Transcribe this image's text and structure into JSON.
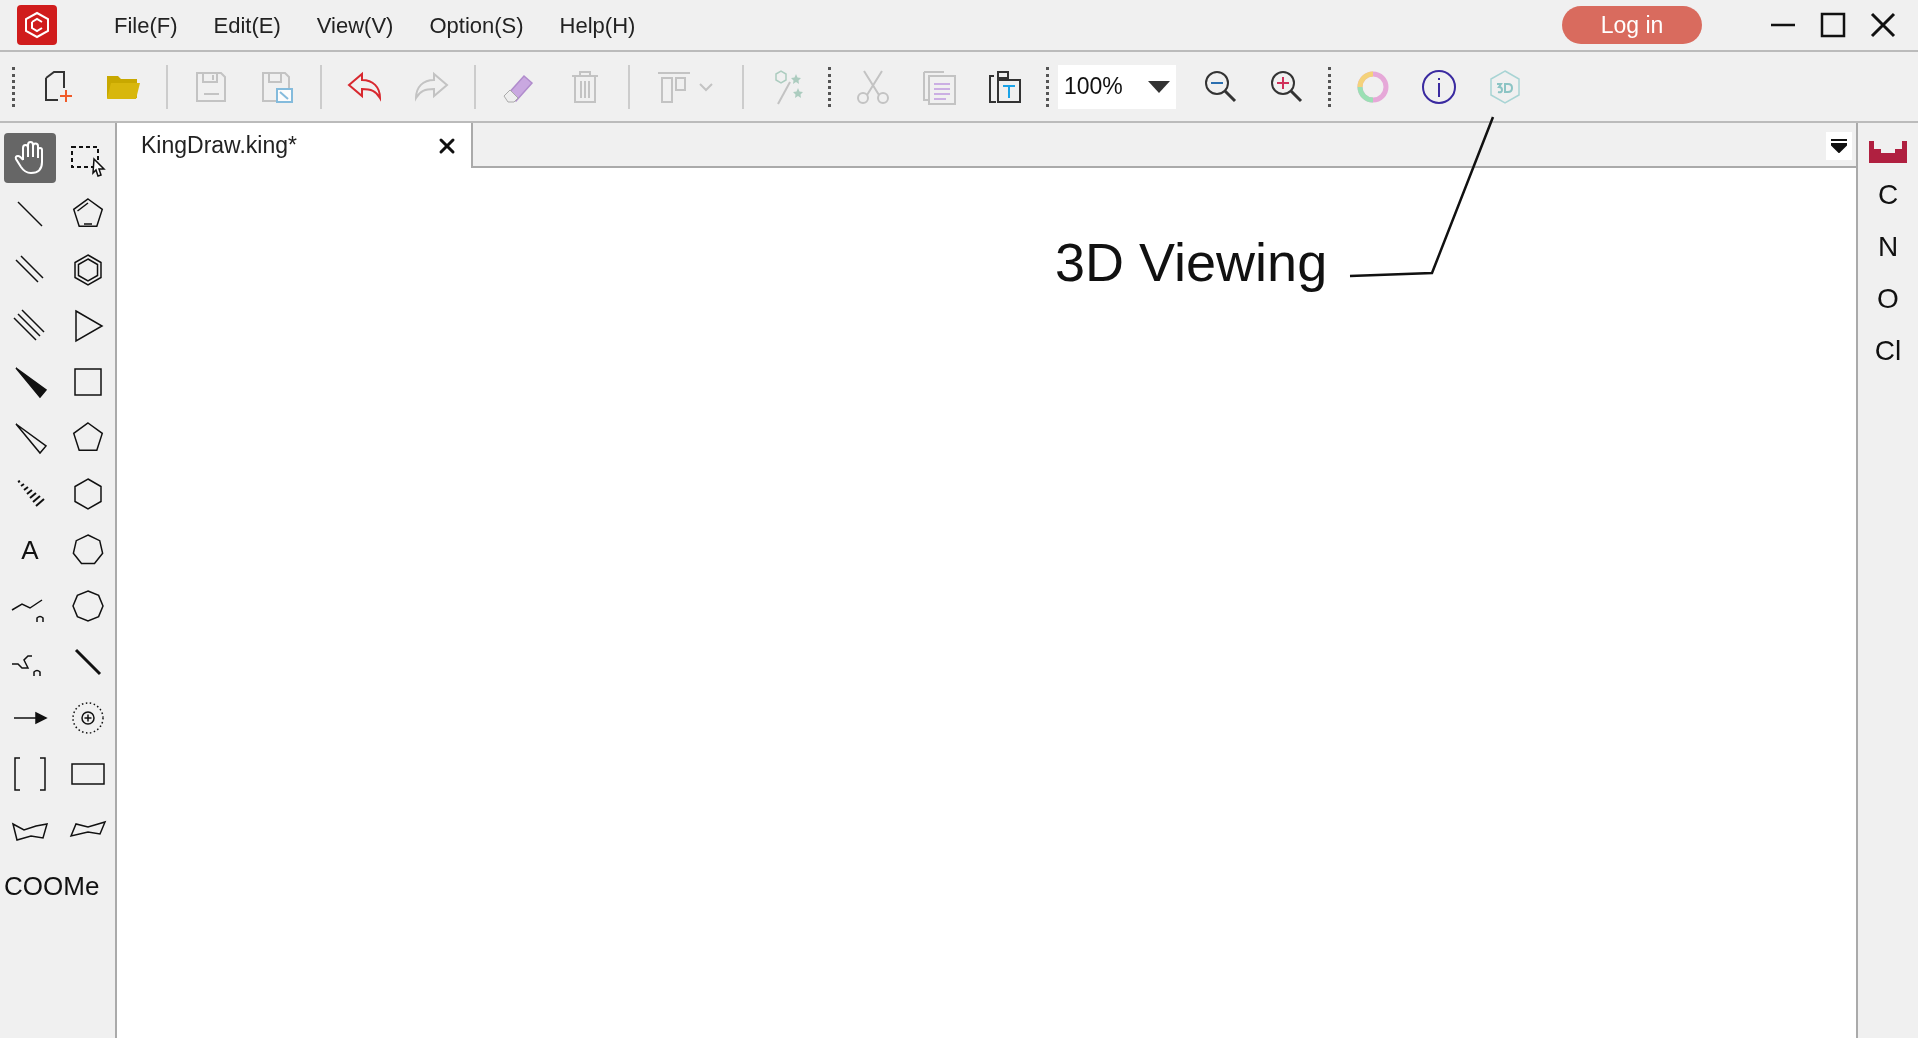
{
  "menu": [
    "File(F)",
    "Edit(E)",
    "View(V)",
    "Option(S)",
    "Help(H)"
  ],
  "login": "Log in",
  "toolbar": [
    {
      "kind": "new",
      "disabled": false
    },
    {
      "kind": "open",
      "disabled": false
    },
    {
      "kind": "sep"
    },
    {
      "kind": "save",
      "disabled": true
    },
    {
      "kind": "saveas",
      "disabled": true
    },
    {
      "kind": "sep"
    },
    {
      "kind": "undo",
      "disabled": false
    },
    {
      "kind": "redo",
      "disabled": true
    },
    {
      "kind": "sep"
    },
    {
      "kind": "eraser",
      "disabled": false
    },
    {
      "kind": "trash",
      "disabled": true
    },
    {
      "kind": "sep"
    },
    {
      "kind": "align",
      "disabled": true
    },
    {
      "kind": "sep"
    },
    {
      "kind": "magic",
      "disabled": true
    },
    {
      "kind": "grip"
    },
    {
      "kind": "cut",
      "disabled": true
    },
    {
      "kind": "copy",
      "disabled": true
    },
    {
      "kind": "paste",
      "disabled": false
    },
    {
      "kind": "grip"
    },
    {
      "kind": "zoom",
      "value": "100%"
    },
    {
      "kind": "zoomout",
      "disabled": false
    },
    {
      "kind": "zoomin",
      "disabled": false
    },
    {
      "kind": "grip"
    },
    {
      "kind": "color",
      "disabled": false
    },
    {
      "kind": "info",
      "disabled": false
    },
    {
      "kind": "cube",
      "disabled": false
    }
  ],
  "tools": [
    {
      "kind": "hand",
      "selected": true
    },
    {
      "kind": "select",
      "selected": false
    },
    {
      "kind": "bond",
      "selected": false
    },
    {
      "kind": "ring5d",
      "selected": false
    },
    {
      "kind": "double",
      "selected": false
    },
    {
      "kind": "benz",
      "selected": false
    },
    {
      "kind": "triple",
      "selected": false
    },
    {
      "kind": "ring3",
      "selected": false
    },
    {
      "kind": "wedge",
      "selected": false
    },
    {
      "kind": "ring4",
      "selected": false
    },
    {
      "kind": "hwedge",
      "selected": false
    },
    {
      "kind": "ring5",
      "selected": false
    },
    {
      "kind": "hash",
      "selected": false
    },
    {
      "kind": "ring6",
      "selected": false
    },
    {
      "kind": "text",
      "label": "A",
      "selected": false
    },
    {
      "kind": "ring7",
      "selected": false
    },
    {
      "kind": "chain",
      "selected": false
    },
    {
      "kind": "ring8",
      "selected": false
    },
    {
      "kind": "chain2",
      "selected": false
    },
    {
      "kind": "boldbond",
      "selected": false
    },
    {
      "kind": "arrow",
      "selected": false
    },
    {
      "kind": "charge",
      "selected": false
    },
    {
      "kind": "bracket",
      "selected": false
    },
    {
      "kind": "rect",
      "selected": false
    },
    {
      "kind": "chair1",
      "selected": false
    },
    {
      "kind": "chair2",
      "selected": false
    },
    {
      "kind": "text",
      "label": "COOMe",
      "selected": false
    }
  ],
  "tab": {
    "title": "KingDraw.king*",
    "selected": true
  },
  "annotation": "3D Viewing",
  "elements": [
    "C",
    "N",
    "O",
    "Cl"
  ]
}
